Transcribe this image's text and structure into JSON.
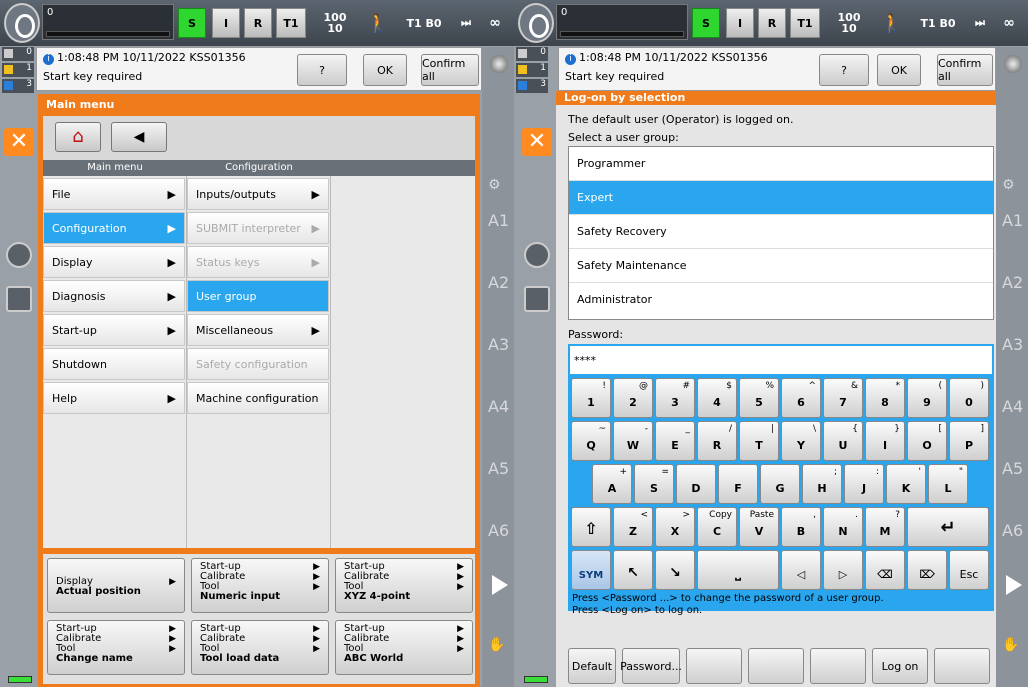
{
  "left": {
    "status_number": "0",
    "mode_buttons": [
      "S",
      "I",
      "R",
      "T1"
    ],
    "override": {
      "prog": "100",
      "jog": "10"
    },
    "infinity": "∞",
    "counts": [
      "0",
      "1",
      "3",
      "0"
    ],
    "message": {
      "time": "1:08:48 PM 10/11/2022 KSS01356",
      "text": "Start key required",
      "help": "?",
      "ok": "OK",
      "confirm_all": "Confirm all"
    },
    "menu_title": "Main menu",
    "col_headers": [
      "Main menu",
      "Configuration"
    ],
    "main_items": [
      "File",
      "Configuration",
      "Display",
      "Diagnosis",
      "Start-up",
      "Shutdown",
      "Help"
    ],
    "config_items": [
      "Inputs/outputs",
      "SUBMIT interpreter",
      "Status keys",
      "User group",
      "Miscellaneous",
      "Safety configuration",
      "Machine configuration"
    ],
    "right_labels": [
      "A1",
      "A2",
      "A3",
      "A4",
      "A5",
      "A6"
    ],
    "cells": [
      {
        "l1": "Display",
        "l2": "",
        "l3": "",
        "bold": "Actual position"
      },
      {
        "l1": "Start-up",
        "l2": "Calibrate",
        "l3": "Tool",
        "bold": "Numeric input"
      },
      {
        "l1": "Start-up",
        "l2": "Calibrate",
        "l3": "Tool",
        "bold": "XYZ 4-point"
      },
      {
        "l1": "Start-up",
        "l2": "Calibrate",
        "l3": "Tool",
        "bold": "Change name"
      },
      {
        "l1": "Start-up",
        "l2": "Calibrate",
        "l3": "Tool",
        "bold": "Tool load data"
      },
      {
        "l1": "Start-up",
        "l2": "Calibrate",
        "l3": "Tool",
        "bold": "ABC World"
      }
    ]
  },
  "right": {
    "logon_title": "Log-on by selection",
    "default_user_text": "The default user (Operator) is logged on.",
    "select_group_label": "Select a user group:",
    "groups": [
      "Programmer",
      "Expert",
      "Safety Recovery",
      "Safety Maintenance",
      "Administrator"
    ],
    "password_label": "Password:",
    "password_value": "****",
    "row1": [
      [
        "1",
        "!"
      ],
      [
        "2",
        "@"
      ],
      [
        "3",
        "#"
      ],
      [
        "4",
        "$"
      ],
      [
        "5",
        "%"
      ],
      [
        "6",
        "^"
      ],
      [
        "7",
        "&"
      ],
      [
        "8",
        "*"
      ],
      [
        "9",
        "("
      ],
      [
        "0",
        ")"
      ]
    ],
    "row2": [
      [
        "Q",
        "~"
      ],
      [
        "W",
        "-"
      ],
      [
        "E",
        "_"
      ],
      [
        "R",
        "/"
      ],
      [
        "T",
        "|"
      ],
      [
        "Y",
        "\\"
      ],
      [
        "U",
        "{"
      ],
      [
        "I",
        "}"
      ],
      [
        "O",
        "["
      ],
      [
        "P",
        "]"
      ]
    ],
    "row3": [
      [
        "A",
        "+"
      ],
      [
        "S",
        "="
      ],
      [
        "D",
        ""
      ],
      [
        "F",
        ""
      ],
      [
        "G",
        ""
      ],
      [
        "H",
        ";"
      ],
      [
        "J",
        ":"
      ],
      [
        "K",
        "'"
      ],
      [
        "L",
        "\""
      ]
    ],
    "row4": [
      [
        "Z",
        "<"
      ],
      [
        "X",
        ">"
      ],
      [
        "C",
        "Copy"
      ],
      [
        "V",
        "Paste"
      ],
      [
        "B",
        ","
      ],
      [
        "N",
        "."
      ],
      [
        "M",
        "?"
      ]
    ],
    "row5": [
      "SYM",
      "↖",
      "↘",
      "⎵",
      "◁",
      "▷",
      "⌫",
      "⌦",
      "Esc"
    ],
    "hint1": "Press <Password ...> to change the password of a user group.",
    "hint2": "Press <Log on> to log on.",
    "softkeys": [
      "Default",
      "Password...",
      "",
      "",
      "",
      "Log on",
      ""
    ]
  }
}
